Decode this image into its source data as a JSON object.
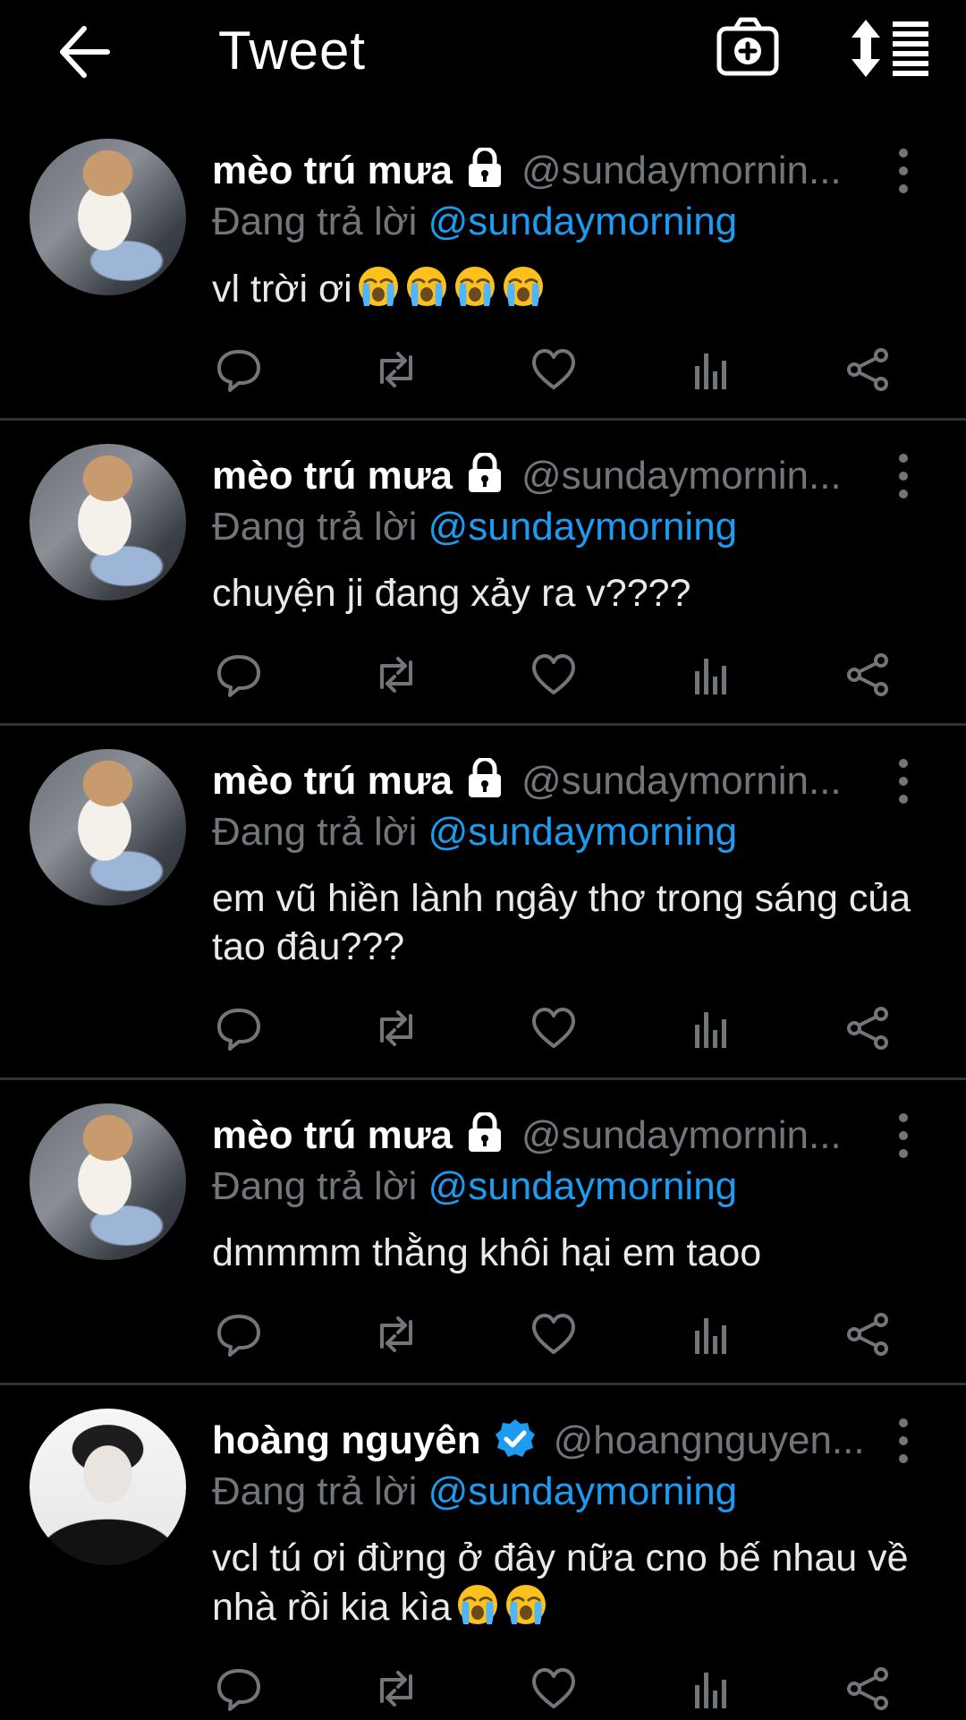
{
  "topbar": {
    "title": "Tweet"
  },
  "tweets": [
    {
      "name": "mèo trú mưa",
      "handle": "@sundaymornin...",
      "badge": "lock",
      "reply_prefix": "Đang trả lời",
      "reply_to": "@sundaymorning",
      "text": "vl trời ơi",
      "emoji": [
        "loudly-crying-face",
        "loudly-crying-face",
        "loudly-crying-face",
        "loudly-crying-face"
      ]
    },
    {
      "name": "mèo trú mưa",
      "handle": "@sundaymornin...",
      "badge": "lock",
      "reply_prefix": "Đang trả lời",
      "reply_to": "@sundaymorning",
      "text": "chuyện ji đang xảy ra v????",
      "emoji": []
    },
    {
      "name": "mèo trú mưa",
      "handle": "@sundaymornin...",
      "badge": "lock",
      "reply_prefix": "Đang trả lời",
      "reply_to": "@sundaymorning",
      "text": "em vũ hiền lành ngây thơ trong sáng của tao đâu???",
      "emoji": []
    },
    {
      "name": "mèo trú mưa",
      "handle": "@sundaymornin...",
      "badge": "lock",
      "reply_prefix": "Đang trả lời",
      "reply_to": "@sundaymorning",
      "text": "dmmmm thằng khôi hại em taoo",
      "emoji": []
    },
    {
      "name": "hoàng nguyên",
      "handle": "@hoangnguyen...",
      "badge": "verified",
      "reply_prefix": "Đang trả lời",
      "reply_to": "@sundaymorning",
      "text": "vcl tú ơi đừng ở đây nữa cno bế nhau về nhà rồi kia kìa",
      "emoji": [
        "loudly-crying-face",
        "loudly-crying-face"
      ]
    }
  ],
  "icons": {
    "back": "arrow-left-icon",
    "camera": "camera-plus-icon",
    "sort": "sort-icon",
    "more": "more-vertical-icon",
    "reply": "reply-icon",
    "retweet": "retweet-icon",
    "like": "heart-icon",
    "views": "analytics-icon",
    "share": "share-icon",
    "lock": "lock-icon",
    "verified": "verified-icon"
  },
  "colors": {
    "background": "#000000",
    "text": "#e7e9ea",
    "muted": "#71767b",
    "accent": "#1d9bf0",
    "divider": "#2f3336"
  }
}
